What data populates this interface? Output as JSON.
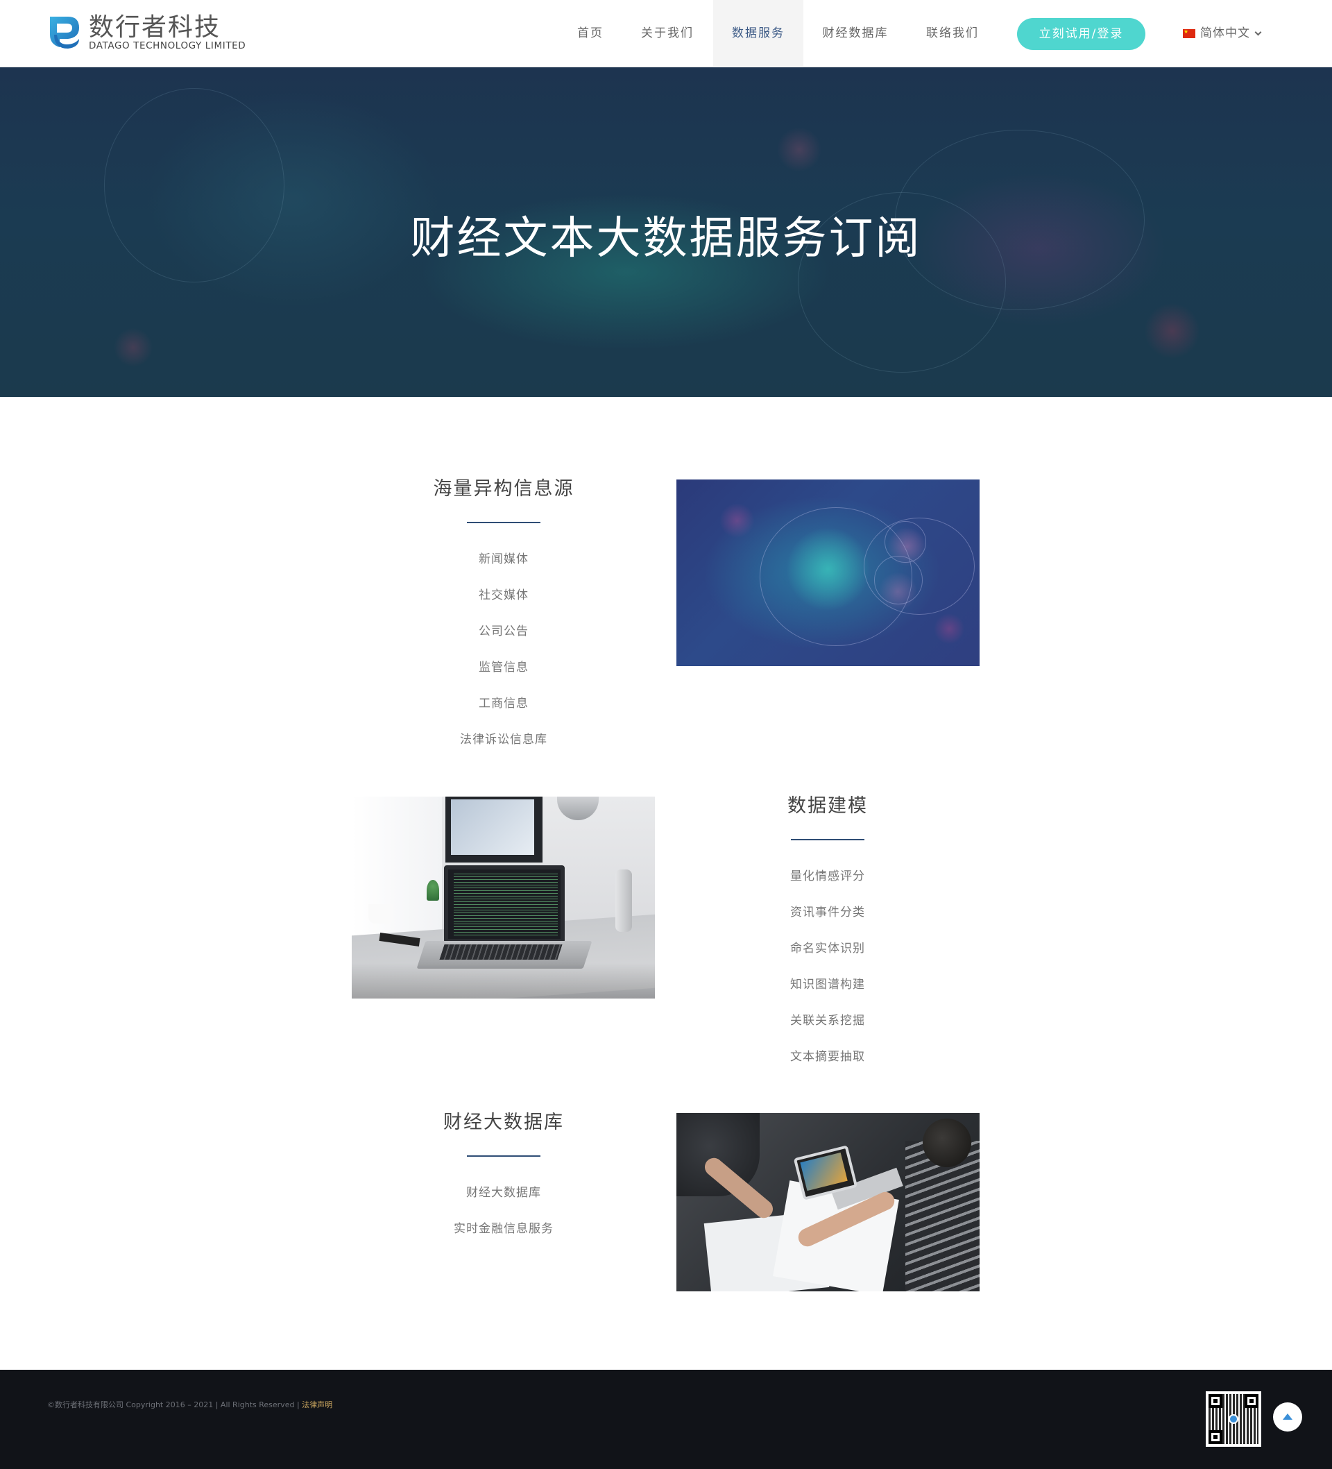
{
  "brand": {
    "name_cn": "数行者科技",
    "name_en": "DATAGO TECHNOLOGY LIMITED",
    "logo_icon": "datago-logo-icon",
    "logo_colors": [
      "#1f6fb8",
      "#3ab0e2"
    ]
  },
  "nav": {
    "items": [
      {
        "label": "首页",
        "active": false
      },
      {
        "label": "关于我们",
        "active": false
      },
      {
        "label": "数据服务",
        "active": true
      },
      {
        "label": "财经数据库",
        "active": false
      },
      {
        "label": "联络我们",
        "active": false
      }
    ],
    "cta_label": "立刻试用/登录",
    "cta_color": "#4fd6cf",
    "language": {
      "label": "简体中文",
      "flag_icon": "china-flag-icon",
      "dropdown_icon": "chevron-down-icon"
    }
  },
  "hero": {
    "title": "财经文本大数据服务订阅"
  },
  "sections": [
    {
      "title": "海量异构信息源",
      "items": [
        "新闻媒体",
        "社交媒体",
        "公司公告",
        "监管信息",
        "工商信息",
        "法律诉讼信息库"
      ],
      "image": "nebula-image"
    },
    {
      "title": "数据建模",
      "items": [
        "量化情感评分",
        "资讯事件分类",
        "命名实体识别",
        "知识图谱构建",
        "关联关系挖掘",
        "文本摘要抽取"
      ],
      "image": "laptop-desk-image"
    },
    {
      "title": "财经大数据库",
      "items": [
        "财经大数据库",
        "实时金融信息服务"
      ],
      "image": "team-meeting-image"
    }
  ],
  "footer": {
    "copyright": "©数行者科技有限公司 Copyright 2016 – 2021 | All Rights Reserved | ",
    "legal_link": "法律声明",
    "qr_icon": "qr-code-icon",
    "back_to_top_icon": "arrow-up-icon"
  },
  "colors": {
    "accent_dark": "#2f4d75",
    "cta": "#4fd6cf",
    "footer_bg": "#111318",
    "legal_link": "#c8a45e"
  }
}
